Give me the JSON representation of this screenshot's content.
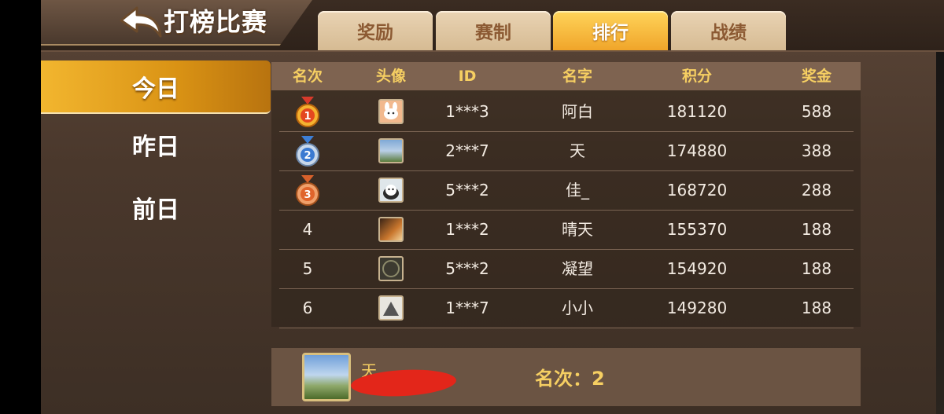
{
  "header": {
    "title": "打榜比赛",
    "tabs": [
      {
        "label": "奖励",
        "active": false
      },
      {
        "label": "赛制",
        "active": false
      },
      {
        "label": "排行",
        "active": true
      },
      {
        "label": "战绩",
        "active": false
      }
    ]
  },
  "sidebar": {
    "items": [
      {
        "label": "今日",
        "active": true
      },
      {
        "label": "昨日",
        "active": false
      },
      {
        "label": "前日",
        "active": false
      }
    ]
  },
  "table": {
    "headers": [
      "名次",
      "头像",
      "ID",
      "名字",
      "积分",
      "奖金"
    ],
    "rows": [
      {
        "rank": "1",
        "medal": "gold-medal-icon",
        "avatar": "rabbit-avatar",
        "id": "1***3",
        "name": "阿白",
        "score": "181120",
        "prize": "588"
      },
      {
        "rank": "2",
        "medal": "silver-medal-icon",
        "avatar": "landscape-avatar",
        "id": "2***7",
        "name": "天",
        "score": "174880",
        "prize": "388"
      },
      {
        "rank": "3",
        "medal": "bronze-medal-icon",
        "avatar": "cat-avatar",
        "id": "5***2",
        "name": "佳_",
        "score": "168720",
        "prize": "288"
      },
      {
        "rank": "4",
        "medal": "",
        "avatar": "anime-avatar",
        "id": "1***2",
        "name": "晴天",
        "score": "155370",
        "prize": "188"
      },
      {
        "rank": "5",
        "medal": "",
        "avatar": "69-avatar",
        "id": "5***2",
        "name": "凝望",
        "score": "154920",
        "prize": "188"
      },
      {
        "rank": "6",
        "medal": "",
        "avatar": "sketch-avatar",
        "id": "1***7",
        "name": "小小",
        "score": "149280",
        "prize": "188"
      }
    ]
  },
  "footer": {
    "my_name": "天",
    "rank_label": "名次：",
    "rank_value": "2"
  },
  "colors": {
    "accent_gold": "#f6cf62",
    "active_tab": "#f0a52a",
    "inactive_tab": "#d6bb93",
    "redaction": "#e3261a"
  }
}
